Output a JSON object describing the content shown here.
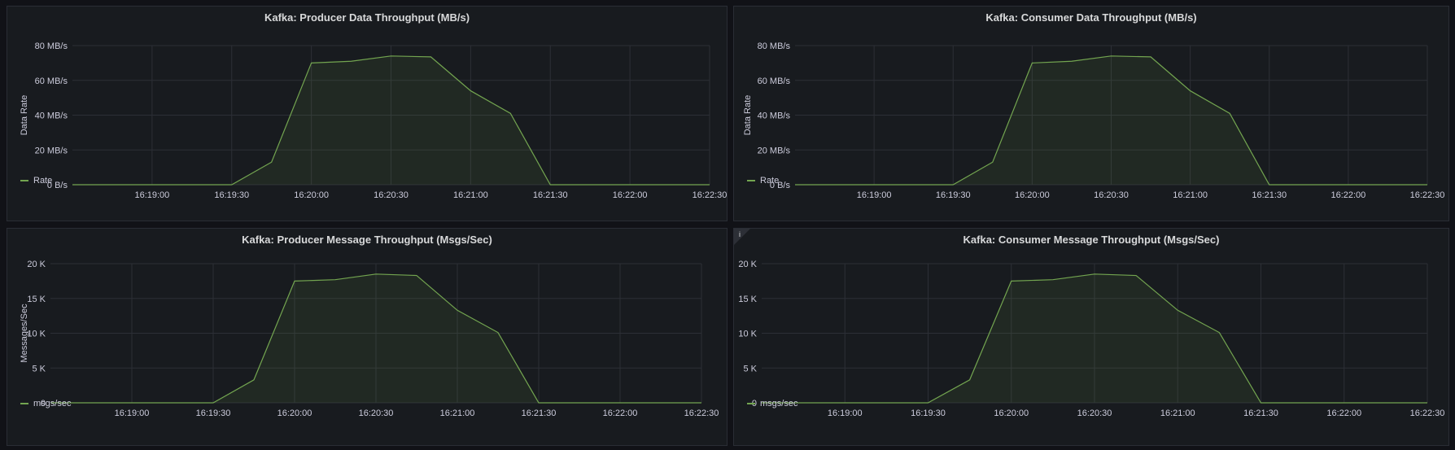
{
  "colors": {
    "series": "#73a550",
    "fill": "rgba(115,165,80,0.10)",
    "grid": "#2c2f36"
  },
  "chart_data": [
    {
      "type": "area",
      "title": "Kafka: Producer Data Throughput (MB/s)",
      "ylabel": "Data Rate",
      "xticks": [
        "16:19:00",
        "16:19:30",
        "16:20:00",
        "16:20:30",
        "16:21:00",
        "16:21:30",
        "16:22:00",
        "16:22:30"
      ],
      "yticks": [
        "0 B/s",
        "20 MB/s",
        "40 MB/s",
        "60 MB/s",
        "80 MB/s"
      ],
      "xlim": [
        "16:18:30",
        "16:22:30"
      ],
      "ylim": [
        0,
        80
      ],
      "x": [
        "16:18:30",
        "16:18:45",
        "16:19:00",
        "16:19:15",
        "16:19:30",
        "16:19:45",
        "16:20:00",
        "16:20:15",
        "16:20:30",
        "16:20:45",
        "16:21:00",
        "16:21:15",
        "16:21:30",
        "16:21:45",
        "16:22:00",
        "16:22:15",
        "16:22:30"
      ],
      "series": [
        {
          "name": "Rate",
          "values": [
            0,
            0,
            0,
            0,
            0,
            13,
            70,
            71,
            74,
            73.5,
            54,
            41,
            0,
            0,
            0,
            0,
            0
          ]
        }
      ],
      "legend": "bottom-left",
      "info_icon": false
    },
    {
      "type": "area",
      "title": "Kafka: Consumer Data Throughput (MB/s)",
      "ylabel": "Data Rate",
      "xticks": [
        "16:19:00",
        "16:19:30",
        "16:20:00",
        "16:20:30",
        "16:21:00",
        "16:21:30",
        "16:22:00",
        "16:22:30"
      ],
      "yticks": [
        "0 B/s",
        "20 MB/s",
        "40 MB/s",
        "60 MB/s",
        "80 MB/s"
      ],
      "xlim": [
        "16:18:30",
        "16:22:30"
      ],
      "ylim": [
        0,
        80
      ],
      "x": [
        "16:18:30",
        "16:18:45",
        "16:19:00",
        "16:19:15",
        "16:19:30",
        "16:19:45",
        "16:20:00",
        "16:20:15",
        "16:20:30",
        "16:20:45",
        "16:21:00",
        "16:21:15",
        "16:21:30",
        "16:21:45",
        "16:22:00",
        "16:22:15",
        "16:22:30"
      ],
      "series": [
        {
          "name": "Rate",
          "values": [
            0,
            0,
            0,
            0,
            0,
            13,
            70,
            71,
            74,
            73.5,
            54,
            41,
            0,
            0,
            0,
            0,
            0
          ]
        }
      ],
      "legend": "bottom-left",
      "info_icon": false
    },
    {
      "type": "area",
      "title": "Kafka: Producer Message Throughput (Msgs/Sec)",
      "ylabel": "Messages/Sec",
      "xticks": [
        "16:19:00",
        "16:19:30",
        "16:20:00",
        "16:20:30",
        "16:21:00",
        "16:21:30",
        "16:22:00",
        "16:22:30"
      ],
      "yticks": [
        "0",
        "5 K",
        "10 K",
        "15 K",
        "20 K"
      ],
      "xlim": [
        "16:18:30",
        "16:22:30"
      ],
      "ylim": [
        0,
        20000
      ],
      "x": [
        "16:18:30",
        "16:18:45",
        "16:19:00",
        "16:19:15",
        "16:19:30",
        "16:19:45",
        "16:20:00",
        "16:20:15",
        "16:20:30",
        "16:20:45",
        "16:21:00",
        "16:21:15",
        "16:21:30",
        "16:21:45",
        "16:22:00",
        "16:22:15",
        "16:22:30"
      ],
      "series": [
        {
          "name": "msgs/sec",
          "values": [
            0,
            0,
            0,
            0,
            0,
            3300,
            17500,
            17700,
            18500,
            18300,
            13300,
            10100,
            0,
            0,
            0,
            0,
            0
          ]
        }
      ],
      "legend": "bottom-left",
      "info_icon": false
    },
    {
      "type": "area",
      "title": "Kafka: Consumer Message Throughput (Msgs/Sec)",
      "ylabel": "",
      "xticks": [
        "16:19:00",
        "16:19:30",
        "16:20:00",
        "16:20:30",
        "16:21:00",
        "16:21:30",
        "16:22:00",
        "16:22:30"
      ],
      "yticks": [
        "0",
        "5 K",
        "10 K",
        "15 K",
        "20 K"
      ],
      "xlim": [
        "16:18:30",
        "16:22:30"
      ],
      "ylim": [
        0,
        20000
      ],
      "x": [
        "16:18:30",
        "16:18:45",
        "16:19:00",
        "16:19:15",
        "16:19:30",
        "16:19:45",
        "16:20:00",
        "16:20:15",
        "16:20:30",
        "16:20:45",
        "16:21:00",
        "16:21:15",
        "16:21:30",
        "16:21:45",
        "16:22:00",
        "16:22:15",
        "16:22:30"
      ],
      "series": [
        {
          "name": "msgs/sec",
          "values": [
            0,
            0,
            0,
            0,
            0,
            3300,
            17500,
            17700,
            18500,
            18300,
            13300,
            10100,
            0,
            0,
            0,
            0,
            0
          ]
        }
      ],
      "legend": "bottom-left",
      "info_icon": true,
      "info_icon_glyph": "i"
    }
  ]
}
